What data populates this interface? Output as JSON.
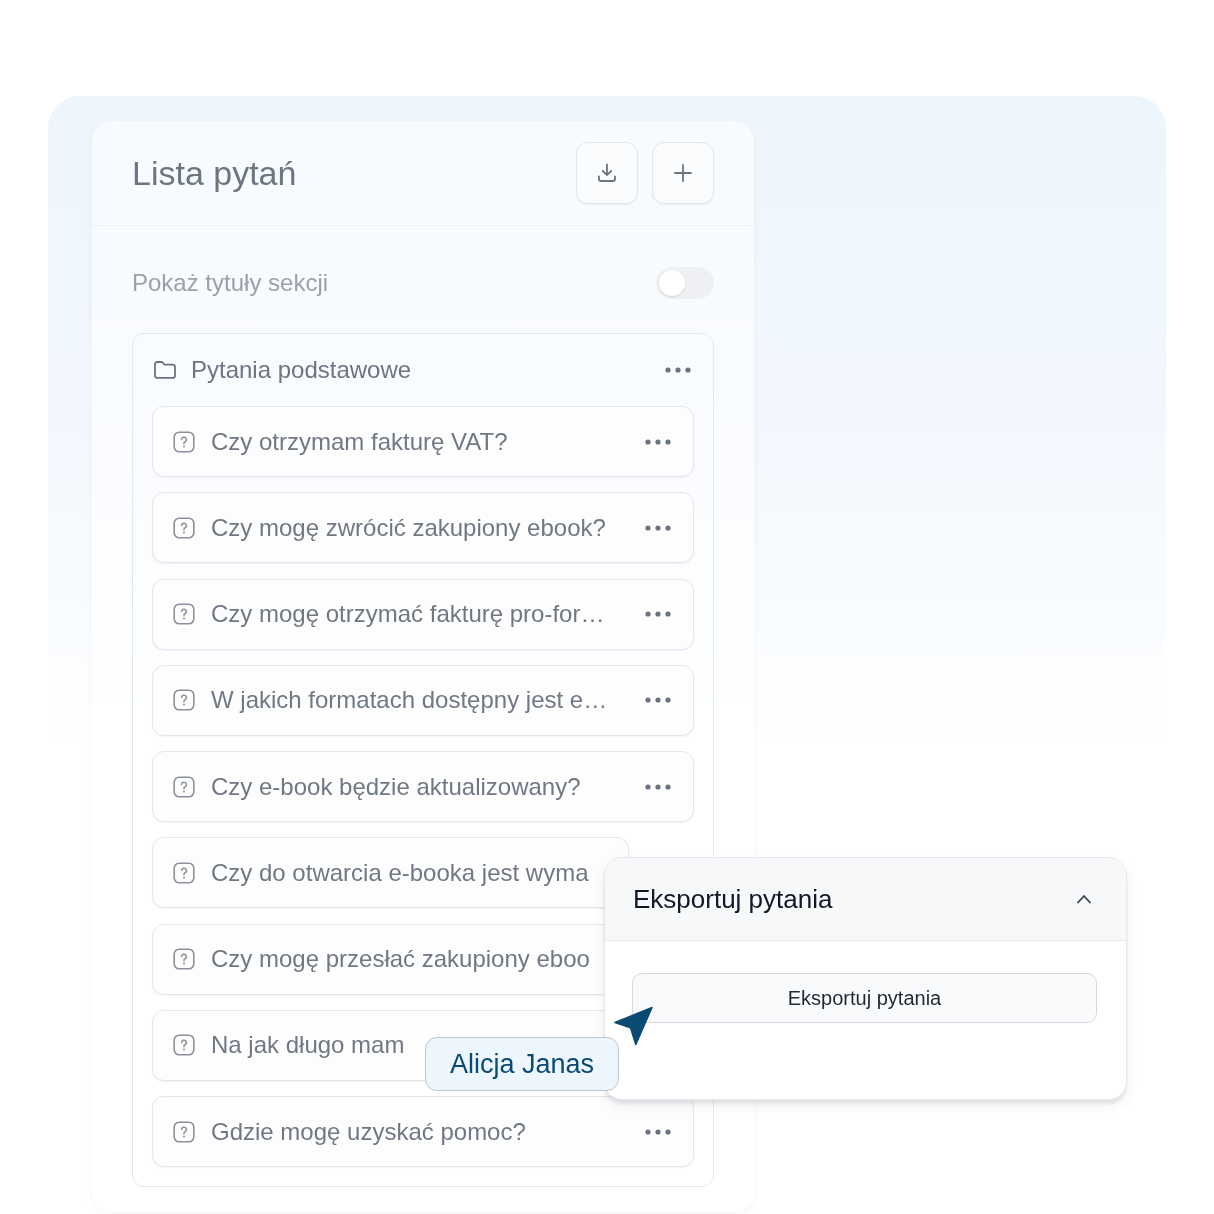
{
  "panel": {
    "title": "Lista pytań"
  },
  "section_titles_toggle": {
    "label": "Pokaż tytuły sekcji",
    "on": false
  },
  "folder": {
    "name": "Pytania podstawowe",
    "questions": [
      {
        "text": "Czy otrzymam fakturę VAT?"
      },
      {
        "text": "Czy mogę zwrócić zakupiony ebook?"
      },
      {
        "text": "Czy mogę otrzymać fakturę pro-for…"
      },
      {
        "text": "W jakich formatach dostępny jest e…"
      },
      {
        "text": "Czy e-book będzie aktualizowany?"
      },
      {
        "text": "Czy do otwarcia e-booka jest wyma"
      },
      {
        "text": "Czy mogę przesłać zakupiony eboo"
      },
      {
        "text": "Na jak długo mam"
      },
      {
        "text": "Gdzie mogę uzyskać pomoc?"
      }
    ]
  },
  "export_panel": {
    "title": "Eksportuj pytania",
    "expanded": true,
    "button": "Eksportuj pytania"
  },
  "cursor": {
    "user": "Alicja Janas"
  }
}
